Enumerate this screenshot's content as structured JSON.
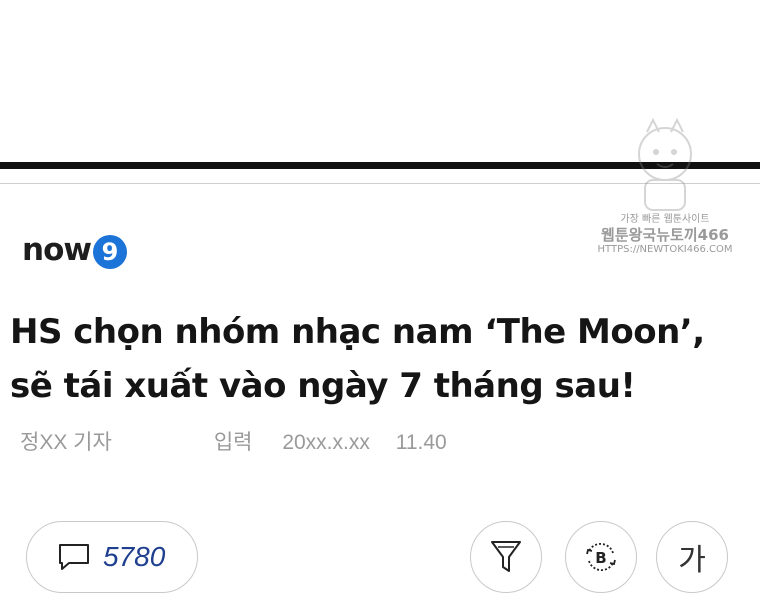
{
  "watermark": {
    "line1": "가장 빠른 웹툰사이트",
    "line2": "웹툰왕국뉴토끼466",
    "line3": "HTTPS://NEWTOKI466.COM"
  },
  "brand": {
    "name": "now",
    "badge": "9",
    "accent_color": "#1d74d8"
  },
  "headline": {
    "line1": "HS chọn nhóm nhạc nam ‘The Moon’,",
    "line2": "sẽ tái xuất vào ngày 7 tháng sau!"
  },
  "byline": {
    "reporter": "정XX 기자",
    "input_label": "입력",
    "date": "20xx.x.xx",
    "time": "11.40"
  },
  "actions": {
    "comment_icon": "comment-bubble-icon",
    "comment_count": "5780",
    "filter_icon": "filter-funnel-icon",
    "bookmark_icon": "refresh-b-icon",
    "font_size_label": "가"
  }
}
